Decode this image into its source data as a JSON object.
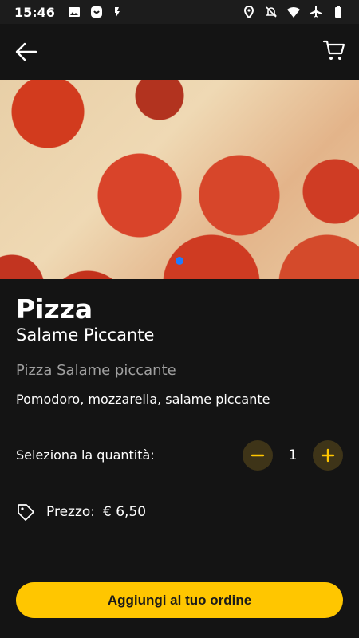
{
  "status_bar": {
    "time": "15:46",
    "icons_left": [
      "image-icon",
      "app-icon",
      "notification-icon"
    ],
    "icons_right": [
      "location-icon",
      "mute-icon",
      "wifi-icon",
      "airplane-icon",
      "battery-icon"
    ]
  },
  "app_bar": {
    "back_icon": "arrow-left-icon",
    "cart_icon": "cart-icon"
  },
  "product": {
    "category": "Pizza",
    "name": "Salame Piccante",
    "description": "Pizza Salame piccante",
    "ingredients": "Pomodoro, mozzarella, salame piccante",
    "image_count_indicator": 1
  },
  "quantity": {
    "label": "Seleziona la quantità:",
    "value": "1",
    "minus": "−",
    "plus": "+"
  },
  "price": {
    "label": "Prezzo:",
    "value": "€ 6,50"
  },
  "cta": {
    "label": "Aggiungi al tuo ordine"
  },
  "colors": {
    "background": "#141414",
    "accent": "#ffc600",
    "stepper_bg": "#3e3418",
    "carousel_dot": "#1f7cff"
  }
}
